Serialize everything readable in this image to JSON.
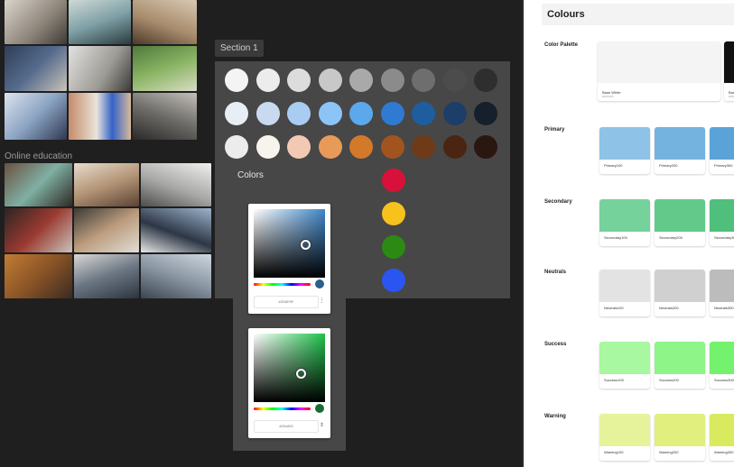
{
  "photos": {
    "label": "Online education"
  },
  "section": {
    "tag": "Section 1",
    "swatch_rows": [
      [
        "#f4f4f4",
        "#ececec",
        "#dcdcdc",
        "#c8c8c8",
        "#a9a9a9",
        "#8b8b8b",
        "#6e6e6e",
        "#4c4c4c",
        "#2e2e2e"
      ],
      [
        "#e8eef5",
        "#c9daf0",
        "#a9cdf2",
        "#8cc4f7",
        "#5ca8ec",
        "#2f7bd2",
        "#1f5e9e",
        "#1c3e69",
        "#15202c"
      ],
      [
        "#ececec",
        "#f6f4ec",
        "#f2c9b3",
        "#e89b58",
        "#d27a2a",
        "#a2541f",
        "#6e3a17",
        "#4a2612",
        "#2a1710"
      ]
    ],
    "accent_swatches": [
      "#d8113a",
      "#f8c21d",
      "#2c8a14",
      "#2b55f0"
    ]
  },
  "colors_panel": {
    "label": "Colors",
    "pickers": [
      {
        "hex": "#2D6E9F",
        "hue": "#3f86c8",
        "accent": "#2a5f8e"
      },
      {
        "hex": "#00c853",
        "hue": "#1ec24a",
        "accent": "#1b6b33"
      }
    ]
  },
  "doc": {
    "title": "Colours",
    "groups": [
      {
        "label": "Color Palette",
        "cards": [
          {
            "name": "Base White",
            "hex": "#FFFFFF",
            "color": "#f4f4f4"
          },
          {
            "name": "Base",
            "hex": "#000000",
            "color": "#121212"
          }
        ]
      },
      {
        "label": "Primary",
        "cards": [
          {
            "name": "Primary100",
            "hex": "",
            "color": "#8ec2e6"
          },
          {
            "name": "Primary200",
            "hex": "",
            "color": "#74b2e0"
          },
          {
            "name": "Primary300",
            "hex": "",
            "color": "#5aa3d9"
          }
        ]
      },
      {
        "label": "Secondary",
        "cards": [
          {
            "name": "Secondary100",
            "hex": "",
            "color": "#76d29b"
          },
          {
            "name": "Secondary200",
            "hex": "",
            "color": "#62c98b"
          },
          {
            "name": "Secondary300",
            "hex": "",
            "color": "#4fbf7b"
          }
        ]
      },
      {
        "label": "Neutrals",
        "cards": [
          {
            "name": "Neutrals100",
            "hex": "",
            "color": "#e3e3e3"
          },
          {
            "name": "Neutrals200",
            "hex": "",
            "color": "#d0d0d0"
          },
          {
            "name": "Neutrals300",
            "hex": "",
            "color": "#bcbcbc"
          }
        ]
      },
      {
        "label": "Success",
        "cards": [
          {
            "name": "Success100",
            "hex": "",
            "color": "#a8f7a1"
          },
          {
            "name": "Success200",
            "hex": "",
            "color": "#8ef588"
          },
          {
            "name": "Success300",
            "hex": "",
            "color": "#74f16d"
          }
        ]
      },
      {
        "label": "Warning",
        "cards": [
          {
            "name": "Warning100",
            "hex": "",
            "color": "#e6f39b"
          },
          {
            "name": "Warning200",
            "hex": "",
            "color": "#e0ef7d"
          },
          {
            "name": "Warning300",
            "hex": "",
            "color": "#d9ea5f"
          }
        ]
      }
    ]
  }
}
